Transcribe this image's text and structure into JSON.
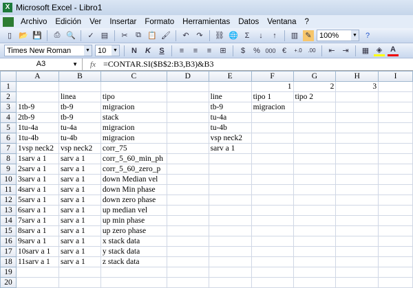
{
  "window": {
    "title": "Microsoft Excel - Libro1"
  },
  "menu": [
    "Archivo",
    "Edición",
    "Ver",
    "Insertar",
    "Formato",
    "Herramientas",
    "Datos",
    "Ventana",
    "?"
  ],
  "toolbar": {
    "zoom": "100%"
  },
  "format_toolbar": {
    "font": "Times New Roman",
    "size": "10",
    "bold": "N",
    "italic": "K",
    "underline": "S",
    "currency": "$",
    "percent": "%",
    "thousands": "000",
    "euro": "€"
  },
  "formula_bar": {
    "cell": "A3",
    "fx": "fx",
    "formula": "=CONTAR.SI($B$2:B3,B3)&B3"
  },
  "columns": [
    "A",
    "B",
    "C",
    "D",
    "E",
    "F",
    "G",
    "H",
    "I"
  ],
  "rows": [
    [
      "",
      "",
      "",
      "",
      "",
      "1",
      "2",
      "3",
      ""
    ],
    [
      "",
      "linea",
      "tipo",
      "",
      "line",
      "tipo 1",
      "tipo 2",
      "",
      ""
    ],
    [
      "1tb-9",
      "tb-9",
      "migracion",
      "",
      "tb-9",
      "migracion",
      "",
      "",
      ""
    ],
    [
      "2tb-9",
      "tb-9",
      "stack",
      "",
      "tu-4a",
      "",
      "",
      "",
      ""
    ],
    [
      "1tu-4a",
      "tu-4a",
      "migracion",
      "",
      "tu-4b",
      "",
      "",
      "",
      ""
    ],
    [
      "1tu-4b",
      "tu-4b",
      "migracion",
      "",
      "vsp neck2",
      "",
      "",
      "",
      ""
    ],
    [
      "1vsp neck2",
      "vsp neck2",
      "corr_75",
      "",
      "sarv a 1",
      "",
      "",
      "",
      ""
    ],
    [
      "1sarv a 1",
      "sarv a 1",
      "corr_5_60_min_ph",
      "",
      "",
      "",
      "",
      "",
      ""
    ],
    [
      "2sarv a 1",
      "sarv a 1",
      "corr_5_60_zero_p",
      "",
      "",
      "",
      "",
      "",
      ""
    ],
    [
      "3sarv a 1",
      "sarv a 1",
      "down Median vel",
      "",
      "",
      "",
      "",
      "",
      ""
    ],
    [
      "4sarv a 1",
      "sarv a 1",
      "down Min phase",
      "",
      "",
      "",
      "",
      "",
      ""
    ],
    [
      "5sarv a 1",
      "sarv a 1",
      "down zero phase",
      "",
      "",
      "",
      "",
      "",
      ""
    ],
    [
      "6sarv a 1",
      "sarv a 1",
      "up median vel",
      "",
      "",
      "",
      "",
      "",
      ""
    ],
    [
      "7sarv a 1",
      "sarv a 1",
      "up min phase",
      "",
      "",
      "",
      "",
      "",
      ""
    ],
    [
      "8sarv a 1",
      "sarv a 1",
      "up zero phase",
      "",
      "",
      "",
      "",
      "",
      ""
    ],
    [
      "9sarv a 1",
      "sarv a 1",
      "x stack data",
      "",
      "",
      "",
      "",
      "",
      ""
    ],
    [
      "10sarv a 1",
      "sarv a 1",
      "y stack data",
      "",
      "",
      "",
      "",
      "",
      ""
    ],
    [
      "11sarv a 1",
      "sarv a 1",
      "z stack data",
      "",
      "",
      "",
      "",
      "",
      ""
    ],
    [
      "",
      "",
      "",
      "",
      "",
      "",
      "",
      "",
      ""
    ],
    [
      "",
      "",
      "",
      "",
      "",
      "",
      "",
      "",
      ""
    ]
  ]
}
